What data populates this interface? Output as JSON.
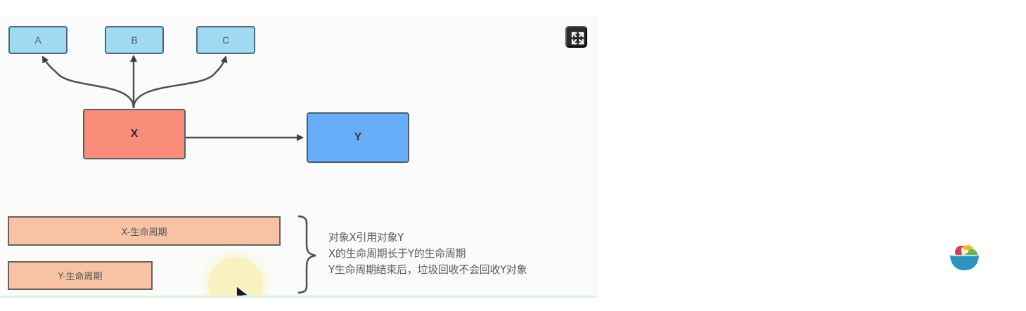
{
  "diagram": {
    "nodes": {
      "a": "A",
      "b": "B",
      "c": "C",
      "x": "X",
      "y": "Y"
    },
    "lifecycles": {
      "x": "X-生命周期",
      "y": "Y-生命周期"
    },
    "description": [
      "对象X引用对象Y",
      "X的生命周期长于Y的生命周期",
      "Y生命周期结束后，垃圾回收不会回收Y对象"
    ],
    "colors": {
      "top_nodes": "#9fdaf0",
      "x_node": "#fa8d7a",
      "y_node": "#67adf8",
      "lifecycle_bars": "#f8c2a4"
    }
  },
  "controls": {
    "fullscreen_icon": "fullscreen-expand-icon",
    "floating_icon": "colorful-bowl-app-icon",
    "cursor_icon": "mouse-pointer-icon"
  }
}
